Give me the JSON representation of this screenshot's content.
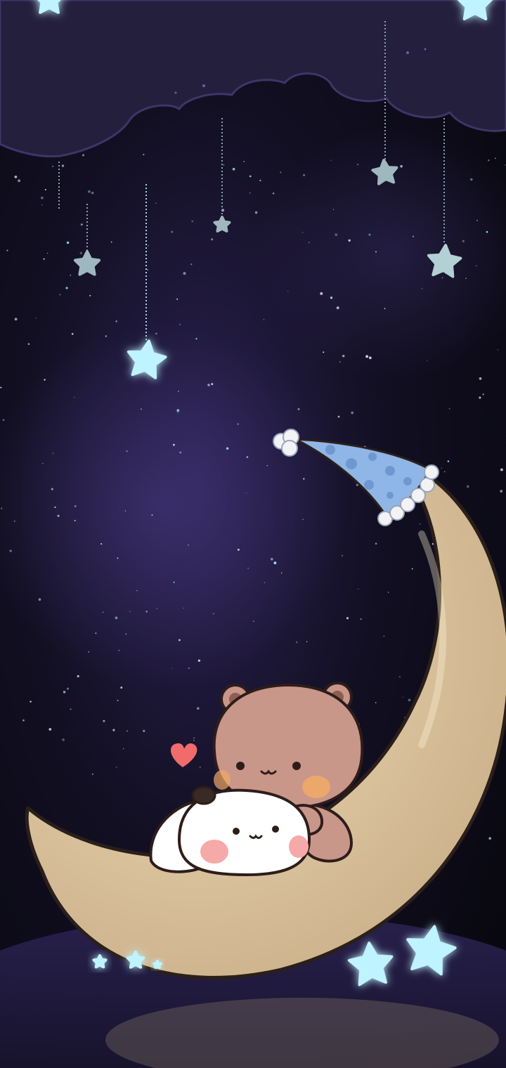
{
  "screen": {
    "type": "phone-wallpaper",
    "content": "illustration-only",
    "visible_text": []
  },
  "colors": {
    "sky_top": "#1a1530",
    "sky_mid": "#0d0b17",
    "nebula": "#3a2f6a",
    "cloud": "#2b2548",
    "cloud_edge": "#443a6e",
    "moon": "#dcc4a0",
    "moon_shadow": "#b89a78",
    "nightcap": "#8fb6e6",
    "nightcap_dots": "#6f98d0",
    "pompom": "#f3f3f6",
    "bear": "#c9968a",
    "bear_dark": "#a27565",
    "panda_white": "#ffffff",
    "blush": "#f6a9a9",
    "outline": "#2d1d1a",
    "heart": "#f26b6b",
    "star_glow": "#bff3ff",
    "star_dim": "#9fb7bf"
  },
  "icons": {
    "hanging_stars": "star-icon",
    "heart": "heart-icon",
    "floor_stars": "star-icon"
  }
}
